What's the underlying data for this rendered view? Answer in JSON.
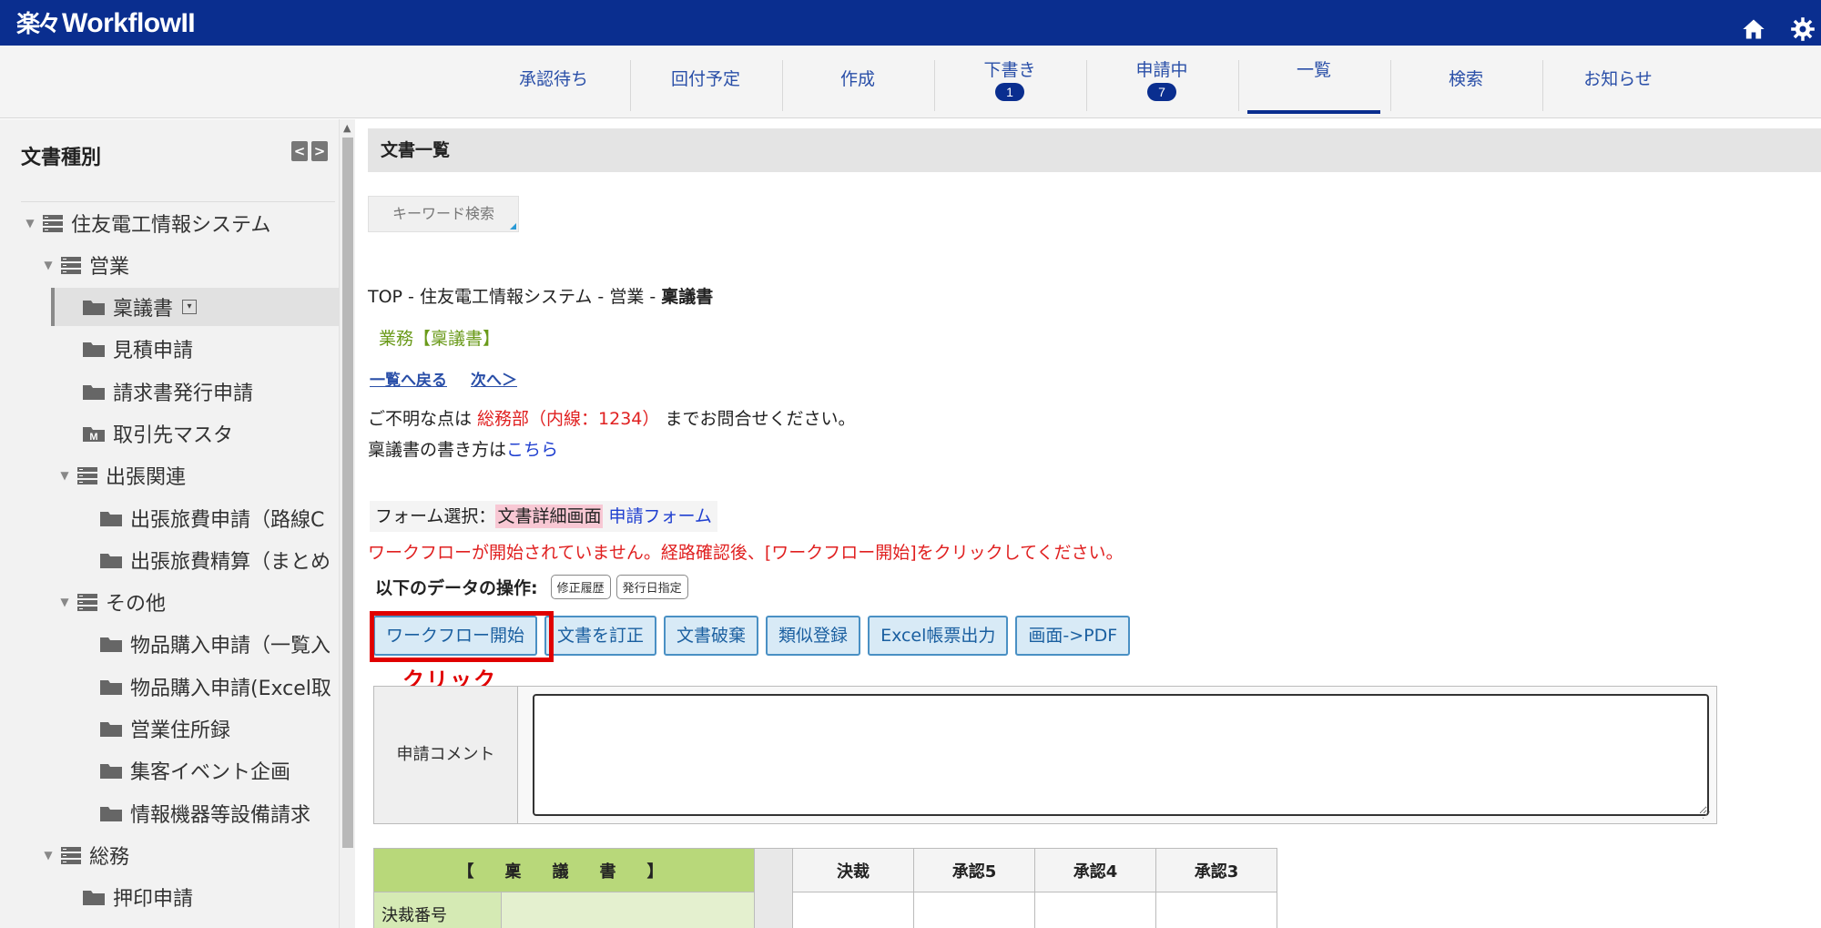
{
  "app": {
    "logo_mark": "楽々",
    "logo_text": "WorkflowII",
    "brand_color": "#0a2e8f"
  },
  "header_icons": [
    "home-icon",
    "gear-icon"
  ],
  "nav": {
    "tabs": [
      {
        "label": "承認待ち",
        "badge": ""
      },
      {
        "label": "回付予定",
        "badge": ""
      },
      {
        "label": "作成",
        "badge": ""
      },
      {
        "label": "下書き",
        "badge": "1"
      },
      {
        "label": "申請中",
        "badge": "7"
      },
      {
        "label": "一覧",
        "badge": "",
        "active": true
      },
      {
        "label": "検索",
        "badge": ""
      },
      {
        "label": "お知らせ",
        "badge": ""
      }
    ]
  },
  "sidebar": {
    "title": "文書種別",
    "collapse_left": "<",
    "collapse_right": ">",
    "items": [
      {
        "label": "住友電工情報システム",
        "type": "group"
      },
      {
        "label": "営業",
        "type": "group"
      },
      {
        "label": "稟議書",
        "type": "folder",
        "selected": true
      },
      {
        "label": "見積申請",
        "type": "folder"
      },
      {
        "label": "請求書発行申請",
        "type": "folder"
      },
      {
        "label": "取引先マスタ",
        "type": "master",
        "mark": "M"
      },
      {
        "label": "出張関連",
        "type": "group"
      },
      {
        "label": "出張旅費申請（路線C",
        "type": "folder"
      },
      {
        "label": "出張旅費精算（まとめ",
        "type": "folder"
      },
      {
        "label": "その他",
        "type": "group"
      },
      {
        "label": "物品購入申請（一覧入",
        "type": "folder"
      },
      {
        "label": "物品購入申請(Excel取",
        "type": "folder"
      },
      {
        "label": "営業住所録",
        "type": "folder"
      },
      {
        "label": "集客イベント企画",
        "type": "folder"
      },
      {
        "label": "情報機器等設備請求",
        "type": "folder"
      },
      {
        "label": "総務",
        "type": "group"
      },
      {
        "label": "押印申請",
        "type": "folder"
      }
    ]
  },
  "main": {
    "panel_title": "文書一覧",
    "keyword_search": "キーワード検索",
    "breadcrumb_prefix": "TOP - 住友電工情報システム - 営業 - ",
    "breadcrumb_current": "稟議書",
    "business_title": "業務【稟議書】",
    "back_link": "一覧へ戻る",
    "next_link": "次へ＞",
    "info_prefix": "ご不明な点は ",
    "info_contact": "総務部（内線：1234）",
    "info_suffix": " までお問合せください。",
    "howto_prefix": "稟議書の書き方は",
    "howto_link": "こちら",
    "form_select_label": "フォーム選択：",
    "form_select_current": "文書詳細画面",
    "form_select_other": "申請フォーム",
    "warning": "ワークフローが開始されていません。経路確認後、[ワークフロー開始]をクリックしてください。",
    "ops_label": "以下のデータの操作:",
    "ops_buttons": [
      "修正履歴",
      "発行日指定"
    ],
    "action_buttons": [
      "ワークフロー開始",
      "文書を訂正",
      "文書破棄",
      "類似登録",
      "Excel帳票出力",
      "画面->PDF"
    ],
    "click_annotation": "クリック",
    "comment_label": "申請コメント",
    "comment_value": "",
    "table": {
      "title": "【　稟　議　書　】",
      "columns": [
        "決裁",
        "承認5",
        "承認4",
        "承認3"
      ],
      "row_label": "決裁番号"
    }
  }
}
